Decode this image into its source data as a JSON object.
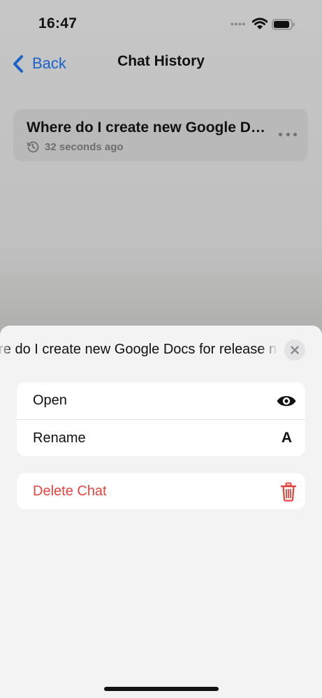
{
  "status_bar": {
    "time": "16:47"
  },
  "nav": {
    "back_label": "Back",
    "title": "Chat History"
  },
  "history": [
    {
      "title": "Where do I create new Google Docs for release notes?",
      "time_ago": "32 seconds ago"
    }
  ],
  "sheet": {
    "title": "Where do I create new Google Docs for release notes?",
    "actions": [
      {
        "label": "Open",
        "icon": "eye-icon"
      },
      {
        "label": "Rename",
        "icon_text": "A"
      }
    ],
    "delete_label": "Delete Chat",
    "delete_icon": "trash-icon"
  },
  "colors": {
    "accent": "#1a63c9",
    "danger": "#e5443f",
    "sheet_bg": "#f3f3f3"
  }
}
